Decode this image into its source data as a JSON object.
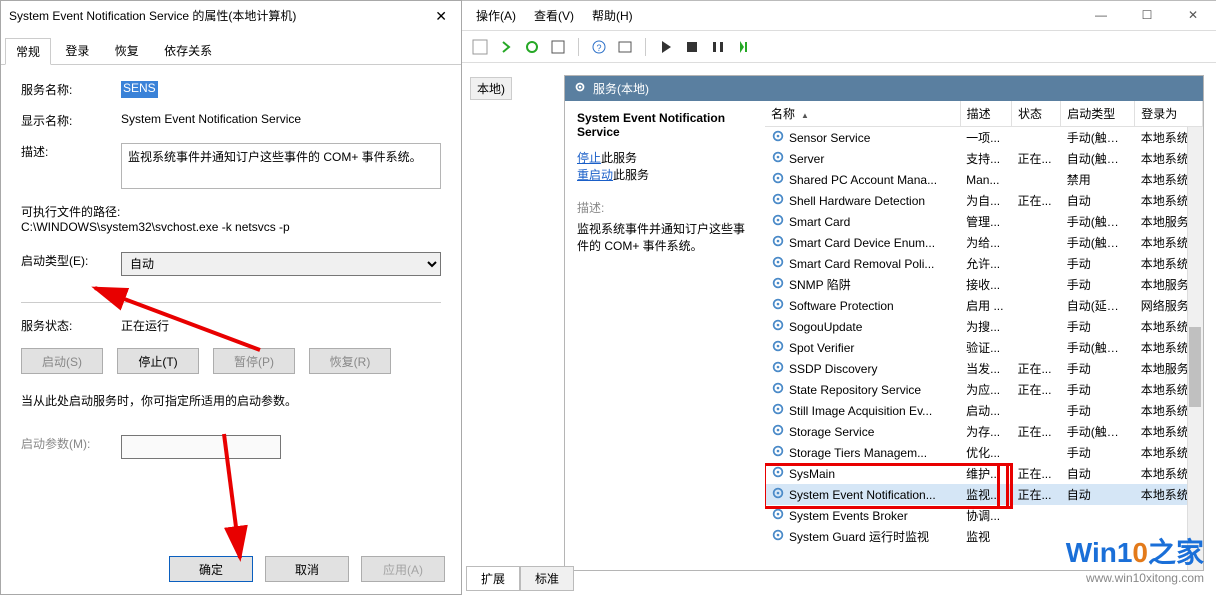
{
  "dialog": {
    "title": "System Event Notification Service 的属性(本地计算机)",
    "tabs": [
      "常规",
      "登录",
      "恢复",
      "依存关系"
    ],
    "activeTab": 0,
    "fields": {
      "serviceName_label": "服务名称:",
      "serviceName": "SENS",
      "displayName_label": "显示名称:",
      "displayName": "System Event Notification Service",
      "description_label": "描述:",
      "description": "监视系统事件并通知订户这些事件的 COM+ 事件系统。",
      "exePath_label": "可执行文件的路径:",
      "exePath": "C:\\WINDOWS\\system32\\svchost.exe -k netsvcs -p",
      "startupType_label": "启动类型(E):",
      "startupType": "自动",
      "status_label": "服务状态:",
      "status": "正在运行",
      "buttons": {
        "start": "启动(S)",
        "stop": "停止(T)",
        "pause": "暂停(P)",
        "resume": "恢复(R)"
      },
      "hint": "当从此处启动服务时，你可指定所适用的启动参数。",
      "startParams_label": "启动参数(M):",
      "startParams": ""
    },
    "footer": {
      "ok": "确定",
      "cancel": "取消",
      "apply": "应用(A)"
    }
  },
  "mainWindow": {
    "controls": {
      "min": "—",
      "max": "☐",
      "close": "✕"
    },
    "menubar": [
      "操作(A)",
      "查看(V)",
      "帮助(H)"
    ],
    "toolbar_icons": [
      "back",
      "forward",
      "up",
      "props",
      "export",
      "help",
      "refresh",
      "sep",
      "play",
      "stop",
      "pause",
      "restart"
    ],
    "leftTree": "本地)",
    "panel": {
      "title": "服务(本地)",
      "detail": {
        "title": "System Event Notification Service",
        "stop_link": "停止",
        "stop_suffix": "此服务",
        "restart_link": "重启动",
        "restart_suffix": "此服务",
        "desc_label": "描述:",
        "desc_text": "监视系统事件并通知订户这些事件的 COM+ 事件系统。"
      },
      "columns": [
        "名称",
        "描述",
        "状态",
        "启动类型",
        "登录为"
      ],
      "rows": [
        {
          "name": "Sensor Service",
          "desc": "一项...",
          "state": "",
          "start": "手动(触发...",
          "logon": "本地系统"
        },
        {
          "name": "Server",
          "desc": "支持...",
          "state": "正在...",
          "start": "自动(触发...",
          "logon": "本地系统"
        },
        {
          "name": "Shared PC Account Mana...",
          "desc": "Man...",
          "state": "",
          "start": "禁用",
          "logon": "本地系统"
        },
        {
          "name": "Shell Hardware Detection",
          "desc": "为自...",
          "state": "正在...",
          "start": "自动",
          "logon": "本地系统"
        },
        {
          "name": "Smart Card",
          "desc": "管理...",
          "state": "",
          "start": "手动(触发...",
          "logon": "本地服务"
        },
        {
          "name": "Smart Card Device Enum...",
          "desc": "为给...",
          "state": "",
          "start": "手动(触发...",
          "logon": "本地系统"
        },
        {
          "name": "Smart Card Removal Poli...",
          "desc": "允许...",
          "state": "",
          "start": "手动",
          "logon": "本地系统"
        },
        {
          "name": "SNMP 陷阱",
          "desc": "接收...",
          "state": "",
          "start": "手动",
          "logon": "本地服务"
        },
        {
          "name": "Software Protection",
          "desc": "启用 ...",
          "state": "",
          "start": "自动(延迟...",
          "logon": "网络服务"
        },
        {
          "name": "SogouUpdate",
          "desc": "为搜...",
          "state": "",
          "start": "手动",
          "logon": "本地系统"
        },
        {
          "name": "Spot Verifier",
          "desc": "验证...",
          "state": "",
          "start": "手动(触发...",
          "logon": "本地系统"
        },
        {
          "name": "SSDP Discovery",
          "desc": "当发...",
          "state": "正在...",
          "start": "手动",
          "logon": "本地服务"
        },
        {
          "name": "State Repository Service",
          "desc": "为应...",
          "state": "正在...",
          "start": "手动",
          "logon": "本地系统"
        },
        {
          "name": "Still Image Acquisition Ev...",
          "desc": "启动...",
          "state": "",
          "start": "手动",
          "logon": "本地系统"
        },
        {
          "name": "Storage Service",
          "desc": "为存...",
          "state": "正在...",
          "start": "手动(触发...",
          "logon": "本地系统"
        },
        {
          "name": "Storage Tiers Managem...",
          "desc": "优化...",
          "state": "",
          "start": "手动",
          "logon": "本地系统"
        },
        {
          "name": "SysMain",
          "desc": "维护...",
          "state": "正在...",
          "start": "自动",
          "logon": "本地系统"
        },
        {
          "name": "System Event Notification...",
          "desc": "监视...",
          "state": "正在...",
          "start": "自动",
          "logon": "本地系统",
          "selected": true
        },
        {
          "name": "System Events Broker",
          "desc": "协调...",
          "state": "",
          "start": "",
          "logon": ""
        },
        {
          "name": "System Guard 运行时监视",
          "desc": "监视",
          "state": "",
          "start": "",
          "logon": ""
        }
      ],
      "bottomTabs": [
        "扩展",
        "标准"
      ]
    }
  },
  "watermark": {
    "brand_html": "Win10之家",
    "url": "www.win10xitong.com"
  }
}
